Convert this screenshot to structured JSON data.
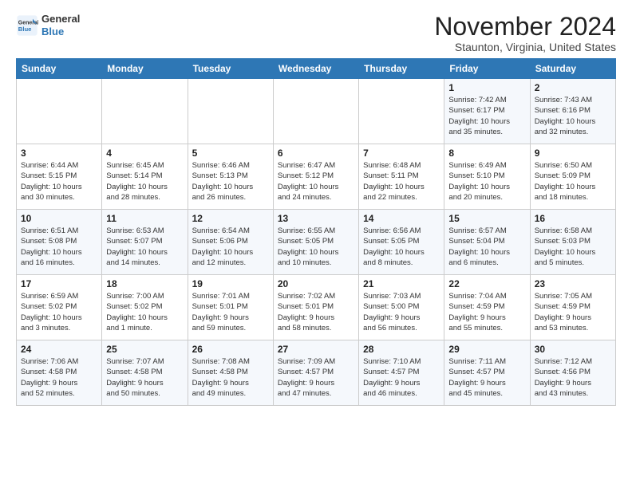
{
  "header": {
    "logo_line1": "General",
    "logo_line2": "Blue",
    "month_title": "November 2024",
    "location": "Staunton, Virginia, United States"
  },
  "weekdays": [
    "Sunday",
    "Monday",
    "Tuesday",
    "Wednesday",
    "Thursday",
    "Friday",
    "Saturday"
  ],
  "weeks": [
    [
      {
        "day": "",
        "info": ""
      },
      {
        "day": "",
        "info": ""
      },
      {
        "day": "",
        "info": ""
      },
      {
        "day": "",
        "info": ""
      },
      {
        "day": "",
        "info": ""
      },
      {
        "day": "1",
        "info": "Sunrise: 7:42 AM\nSunset: 6:17 PM\nDaylight: 10 hours\nand 35 minutes."
      },
      {
        "day": "2",
        "info": "Sunrise: 7:43 AM\nSunset: 6:16 PM\nDaylight: 10 hours\nand 32 minutes."
      }
    ],
    [
      {
        "day": "3",
        "info": "Sunrise: 6:44 AM\nSunset: 5:15 PM\nDaylight: 10 hours\nand 30 minutes."
      },
      {
        "day": "4",
        "info": "Sunrise: 6:45 AM\nSunset: 5:14 PM\nDaylight: 10 hours\nand 28 minutes."
      },
      {
        "day": "5",
        "info": "Sunrise: 6:46 AM\nSunset: 5:13 PM\nDaylight: 10 hours\nand 26 minutes."
      },
      {
        "day": "6",
        "info": "Sunrise: 6:47 AM\nSunset: 5:12 PM\nDaylight: 10 hours\nand 24 minutes."
      },
      {
        "day": "7",
        "info": "Sunrise: 6:48 AM\nSunset: 5:11 PM\nDaylight: 10 hours\nand 22 minutes."
      },
      {
        "day": "8",
        "info": "Sunrise: 6:49 AM\nSunset: 5:10 PM\nDaylight: 10 hours\nand 20 minutes."
      },
      {
        "day": "9",
        "info": "Sunrise: 6:50 AM\nSunset: 5:09 PM\nDaylight: 10 hours\nand 18 minutes."
      }
    ],
    [
      {
        "day": "10",
        "info": "Sunrise: 6:51 AM\nSunset: 5:08 PM\nDaylight: 10 hours\nand 16 minutes."
      },
      {
        "day": "11",
        "info": "Sunrise: 6:53 AM\nSunset: 5:07 PM\nDaylight: 10 hours\nand 14 minutes."
      },
      {
        "day": "12",
        "info": "Sunrise: 6:54 AM\nSunset: 5:06 PM\nDaylight: 10 hours\nand 12 minutes."
      },
      {
        "day": "13",
        "info": "Sunrise: 6:55 AM\nSunset: 5:05 PM\nDaylight: 10 hours\nand 10 minutes."
      },
      {
        "day": "14",
        "info": "Sunrise: 6:56 AM\nSunset: 5:05 PM\nDaylight: 10 hours\nand 8 minutes."
      },
      {
        "day": "15",
        "info": "Sunrise: 6:57 AM\nSunset: 5:04 PM\nDaylight: 10 hours\nand 6 minutes."
      },
      {
        "day": "16",
        "info": "Sunrise: 6:58 AM\nSunset: 5:03 PM\nDaylight: 10 hours\nand 5 minutes."
      }
    ],
    [
      {
        "day": "17",
        "info": "Sunrise: 6:59 AM\nSunset: 5:02 PM\nDaylight: 10 hours\nand 3 minutes."
      },
      {
        "day": "18",
        "info": "Sunrise: 7:00 AM\nSunset: 5:02 PM\nDaylight: 10 hours\nand 1 minute."
      },
      {
        "day": "19",
        "info": "Sunrise: 7:01 AM\nSunset: 5:01 PM\nDaylight: 9 hours\nand 59 minutes."
      },
      {
        "day": "20",
        "info": "Sunrise: 7:02 AM\nSunset: 5:01 PM\nDaylight: 9 hours\nand 58 minutes."
      },
      {
        "day": "21",
        "info": "Sunrise: 7:03 AM\nSunset: 5:00 PM\nDaylight: 9 hours\nand 56 minutes."
      },
      {
        "day": "22",
        "info": "Sunrise: 7:04 AM\nSunset: 4:59 PM\nDaylight: 9 hours\nand 55 minutes."
      },
      {
        "day": "23",
        "info": "Sunrise: 7:05 AM\nSunset: 4:59 PM\nDaylight: 9 hours\nand 53 minutes."
      }
    ],
    [
      {
        "day": "24",
        "info": "Sunrise: 7:06 AM\nSunset: 4:58 PM\nDaylight: 9 hours\nand 52 minutes."
      },
      {
        "day": "25",
        "info": "Sunrise: 7:07 AM\nSunset: 4:58 PM\nDaylight: 9 hours\nand 50 minutes."
      },
      {
        "day": "26",
        "info": "Sunrise: 7:08 AM\nSunset: 4:58 PM\nDaylight: 9 hours\nand 49 minutes."
      },
      {
        "day": "27",
        "info": "Sunrise: 7:09 AM\nSunset: 4:57 PM\nDaylight: 9 hours\nand 47 minutes."
      },
      {
        "day": "28",
        "info": "Sunrise: 7:10 AM\nSunset: 4:57 PM\nDaylight: 9 hours\nand 46 minutes."
      },
      {
        "day": "29",
        "info": "Sunrise: 7:11 AM\nSunset: 4:57 PM\nDaylight: 9 hours\nand 45 minutes."
      },
      {
        "day": "30",
        "info": "Sunrise: 7:12 AM\nSunset: 4:56 PM\nDaylight: 9 hours\nand 43 minutes."
      }
    ]
  ]
}
